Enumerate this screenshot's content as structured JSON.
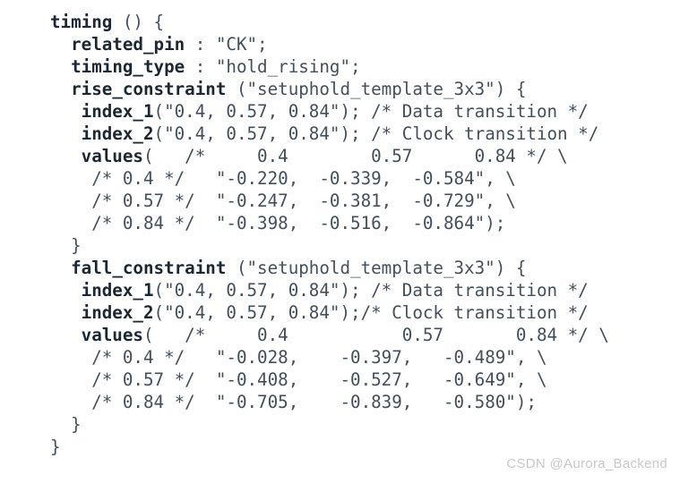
{
  "document": {
    "type": "code-snippet",
    "language": "liberty",
    "background_color": "#ffffff",
    "code_color": "#434f5b",
    "keyword_color": "#1b2733",
    "lines": [
      {
        "indent": "",
        "keyword": "timing",
        "rest": " () {"
      },
      {
        "indent": "  ",
        "keyword": "related_pin",
        "rest": " : \"CK\";"
      },
      {
        "indent": "  ",
        "keyword": "timing_type",
        "rest": " : \"hold_rising\";"
      },
      {
        "indent": "  ",
        "keyword": "rise_constraint",
        "rest": " (\"setuphold_template_3x3\") {"
      },
      {
        "indent": "   ",
        "keyword": "index_1",
        "rest": "(\"0.4, 0.57, 0.84\"); /* Data transition */"
      },
      {
        "indent": "   ",
        "keyword": "index_2",
        "rest": "(\"0.4, 0.57, 0.84\"); /* Clock transition */"
      },
      {
        "indent": "   ",
        "keyword": "values",
        "rest": "(   /*     0.4        0.57      0.84 */ \\"
      },
      {
        "indent": "    ",
        "keyword": "",
        "rest": "/* 0.4 */   \"-0.220,  -0.339,  -0.584\", \\"
      },
      {
        "indent": "    ",
        "keyword": "",
        "rest": "/* 0.57 */  \"-0.247,  -0.381,  -0.729\", \\"
      },
      {
        "indent": "    ",
        "keyword": "",
        "rest": "/* 0.84 */  \"-0.398,  -0.516,  -0.864\");"
      },
      {
        "indent": "  ",
        "keyword": "",
        "rest": "}"
      },
      {
        "indent": "  ",
        "keyword": "fall_constraint",
        "rest": " (\"setuphold_template_3x3\") {"
      },
      {
        "indent": "   ",
        "keyword": "index_1",
        "rest": "(\"0.4, 0.57, 0.84\"); /* Data transition */"
      },
      {
        "indent": "   ",
        "keyword": "index_2",
        "rest": "(\"0.4, 0.57, 0.84\");/* Clock transition */"
      },
      {
        "indent": "   ",
        "keyword": "values",
        "rest": "(   /*     0.4           0.57       0.84 */ \\"
      },
      {
        "indent": "    ",
        "keyword": "",
        "rest": "/* 0.4 */   \"-0.028,    -0.397,   -0.489\", \\"
      },
      {
        "indent": "    ",
        "keyword": "",
        "rest": "/* 0.57 */  \"-0.408,    -0.527,   -0.649\", \\"
      },
      {
        "indent": "    ",
        "keyword": "",
        "rest": "/* 0.84 */  \"-0.705,    -0.839,   -0.580\");"
      },
      {
        "indent": "  ",
        "keyword": "",
        "rest": "}"
      },
      {
        "indent": "",
        "keyword": "",
        "rest": "}"
      }
    ],
    "constraint_data": {
      "related_pin": "CK",
      "timing_type": "hold_rising",
      "template": "setuphold_template_3x3",
      "index_1_label": "Data transition",
      "index_1": [
        "0.4",
        "0.57",
        "0.84"
      ],
      "index_2_label": "Clock transition",
      "index_2": [
        "0.4",
        "0.57",
        "0.84"
      ],
      "rise_constraint_values": [
        [
          "-0.220",
          "-0.339",
          "-0.584"
        ],
        [
          "-0.247",
          "-0.381",
          "-0.729"
        ],
        [
          "-0.398",
          "-0.516",
          "-0.864"
        ]
      ],
      "fall_constraint_values": [
        [
          "-0.028",
          "-0.397",
          "-0.489"
        ],
        [
          "-0.408",
          "-0.527",
          "-0.649"
        ],
        [
          "-0.705",
          "-0.839",
          "-0.580"
        ]
      ]
    }
  },
  "watermark": {
    "text": "CSDN @Aurora_Backend",
    "color": "#c9c9c9"
  }
}
